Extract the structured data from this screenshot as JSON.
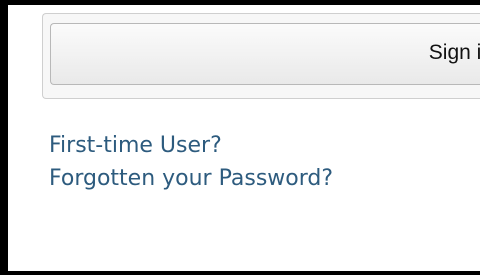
{
  "form": {
    "signin_label": "Sign in"
  },
  "links": {
    "first_time_user": "First-time User?",
    "forgot_password": "Forgotten your Password?"
  },
  "colors": {
    "link": "#2d5b7e",
    "button_text": "#111111",
    "panel_border": "#cfcfcf",
    "button_border": "#b8b8b8"
  }
}
